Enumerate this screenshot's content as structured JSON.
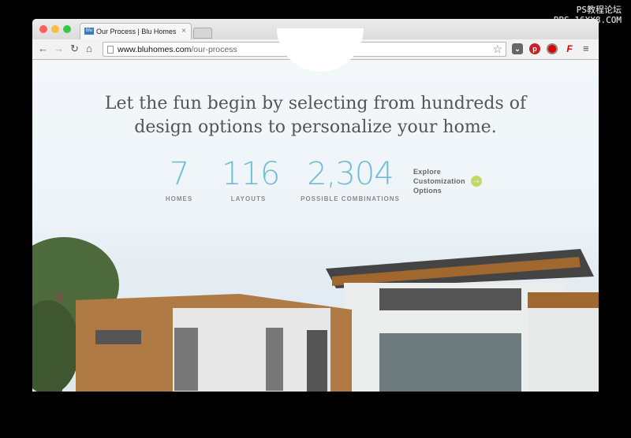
{
  "watermark": {
    "line1": "PS教程论坛",
    "line2": "BBS.16XX8.COM"
  },
  "browser": {
    "tab_title": "Our Process | Blu Homes",
    "favicon_text": "blu",
    "close_icon": "×",
    "url_domain": "www.bluhomes.com",
    "url_path": "/our-process",
    "extensions": [
      "pocket-icon",
      "pinterest-icon",
      "adblock-icon",
      "font-icon"
    ],
    "colors": {
      "pinterest": "#cb2027",
      "adblock": "#e00000"
    }
  },
  "page": {
    "headline_line1": "Let the fun begin by selecting from hundreds of",
    "headline_line2": "design options to personalize your home.",
    "stats": [
      {
        "value": "7",
        "label": "HOMES"
      },
      {
        "value": "116",
        "label": "LAYOUTS"
      },
      {
        "value": "2,304",
        "label": "POSSIBLE COMBINATIONS"
      }
    ],
    "explore": {
      "line1": "Explore",
      "line2": "Customization",
      "line3": "Options"
    },
    "colors": {
      "accent": "#72bdd3",
      "cta": "#c3d86a"
    }
  }
}
